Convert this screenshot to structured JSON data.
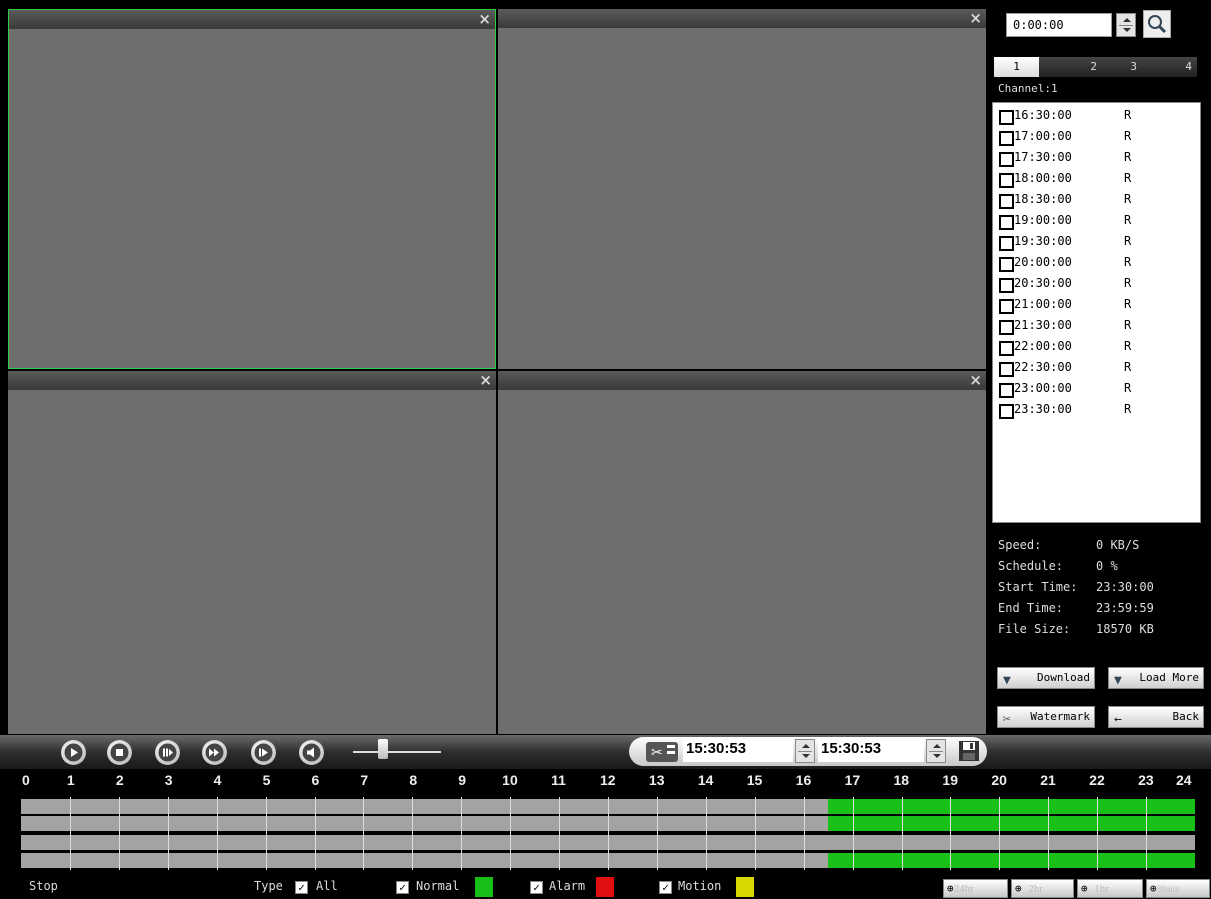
{
  "panes": [
    {
      "name": "video-pane-1",
      "close": "×",
      "active": true
    },
    {
      "name": "video-pane-2",
      "close": "×",
      "active": false
    },
    {
      "name": "video-pane-3",
      "close": "×",
      "active": false
    },
    {
      "name": "video-pane-4",
      "close": "×",
      "active": false
    }
  ],
  "search": {
    "time_value": "0:00:00"
  },
  "channel_tabs": [
    "1",
    "2",
    "3",
    "4"
  ],
  "channel_label": "Channel:1",
  "files": [
    {
      "time": "16:30:00",
      "type": "R"
    },
    {
      "time": "17:00:00",
      "type": "R"
    },
    {
      "time": "17:30:00",
      "type": "R"
    },
    {
      "time": "18:00:00",
      "type": "R"
    },
    {
      "time": "18:30:00",
      "type": "R"
    },
    {
      "time": "19:00:00",
      "type": "R"
    },
    {
      "time": "19:30:00",
      "type": "R"
    },
    {
      "time": "20:00:00",
      "type": "R"
    },
    {
      "time": "20:30:00",
      "type": "R"
    },
    {
      "time": "21:00:00",
      "type": "R"
    },
    {
      "time": "21:30:00",
      "type": "R"
    },
    {
      "time": "22:00:00",
      "type": "R"
    },
    {
      "time": "22:30:00",
      "type": "R"
    },
    {
      "time": "23:00:00",
      "type": "R"
    },
    {
      "time": "23:30:00",
      "type": "R"
    }
  ],
  "info": {
    "speed_label": "Speed:",
    "speed": "0 KB/S",
    "schedule_label": "Schedule:",
    "schedule": "0 %",
    "start_label": "Start Time:",
    "start": "23:30:00",
    "end_label": "End Time:",
    "end": "23:59:59",
    "size_label": "File Size:",
    "size": "18570 KB"
  },
  "buttons": {
    "download": "Download",
    "load_more": "Load More",
    "watermark": "Watermark",
    "back": "Back"
  },
  "clip": {
    "start": "15:30:53",
    "end": "15:30:53"
  },
  "hours": [
    "0",
    "1",
    "2",
    "3",
    "4",
    "5",
    "6",
    "7",
    "8",
    "9",
    "10",
    "11",
    "12",
    "13",
    "14",
    "15",
    "16",
    "17",
    "18",
    "19",
    "20",
    "21",
    "22",
    "23",
    "24"
  ],
  "recordings": [
    {
      "track": 1,
      "from": 16.5,
      "to": 24
    },
    {
      "track": 2,
      "from": 16.5,
      "to": 24
    },
    {
      "track": 4,
      "from": 16.5,
      "to": 24
    }
  ],
  "status": {
    "state": "Stop",
    "type_label": "Type",
    "all": "All",
    "normal": "Normal",
    "alarm": "Alarm",
    "motion": "Motion",
    "check": "✓"
  },
  "colors": {
    "normal": "#18c018",
    "alarm": "#e01010",
    "motion": "#d8d800",
    "active_border": "#2ecc40"
  },
  "zoom": [
    "24hr",
    "2hr",
    "1hr",
    "30min"
  ]
}
